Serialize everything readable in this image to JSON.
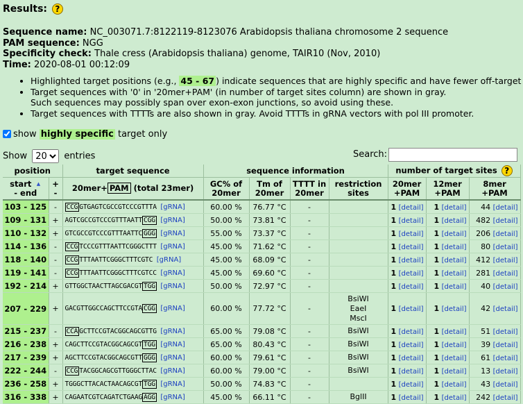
{
  "header": {
    "title": "Results:",
    "help_glyph": "?"
  },
  "info": {
    "seq_label": "Sequence name:",
    "seq_value": "NC_003071.7:8122119-8123076 Arabidopsis thaliana chromosome 2 sequence",
    "pam_label": "PAM sequence:",
    "pam_value": "NGG",
    "spec_label": "Specificity check:",
    "spec_value": "Thale cress (Arabidopsis thaliana) genome, TAIR10 (Nov, 2010)",
    "time_label": "Time:",
    "time_value": "2020-08-01 00:12:09"
  },
  "notes": {
    "n1_a": "Highlighted target positions (e.g., ",
    "n1_hl": "45 - 67",
    "n1_b": ") indicate sequences that are highly specific and have fewer off-target hits.",
    "n2": "Target sequences with '0' in '20mer+PAM' (in number of target sites column) are shown in gray.",
    "n3": "Such sequences may possibly span over exon-exon junctions, so avoid using these.",
    "n4": "Target sequences with TTTTs are also shown in gray. Avoid TTTTs in gRNA vectors with pol III promoter."
  },
  "filter": {
    "show": "show",
    "hl": "highly specific",
    "rest": "target only"
  },
  "entries": {
    "show": "Show",
    "value": "20",
    "suffix": "entries",
    "search_label": "Search:"
  },
  "columns": {
    "position": "position",
    "target_sequence": "target sequence",
    "sequence_information": "sequence information",
    "number_of_target_sites": "number of target sites",
    "start_end_1": "start",
    "start_end_2": "- end",
    "strand_1": "+",
    "strand_2": "-",
    "twentymer": "20mer+",
    "pam": "PAM",
    "total": "(total 23mer)",
    "gc_1": "GC% of",
    "gc_2": "20mer",
    "tm_1": "Tm of",
    "tm_2": "20mer",
    "tttt_1": "TTTT in",
    "tttt_2": "20mer",
    "restr_1": "restriction",
    "restr_2": "sites",
    "c20_1": "20mer",
    "c20_2": "+PAM",
    "c12_1": "12mer",
    "c12_2": "+PAM",
    "c8_1": "8mer",
    "c8_2": "+PAM"
  },
  "labels": {
    "grna": "[gRNA]",
    "detail": "[detail]"
  },
  "rows": [
    {
      "pos": "103 - 125",
      "strand": "-",
      "pre": "",
      "pambox": "CCG",
      "post": "GTGAGTCGCCGTCCCGTTTA",
      "gc": "60.00 %",
      "tm": "76.77 °C",
      "tttt": "-",
      "restr": "",
      "n20": "1",
      "n12": "1",
      "n8": "44"
    },
    {
      "pos": "109 - 131",
      "strand": "+",
      "pre": "AGTCGCCGTCCCGTTTAATT",
      "pambox": "CGG",
      "post": "",
      "gc": "50.00 %",
      "tm": "73.81 °C",
      "tttt": "-",
      "restr": "",
      "n20": "1",
      "n12": "1",
      "n8": "482"
    },
    {
      "pos": "110 - 132",
      "strand": "+",
      "pre": "GTCGCCGTCCCGTTTAATTC",
      "pambox": "GGG",
      "post": "",
      "gc": "55.00 %",
      "tm": "73.37 °C",
      "tttt": "-",
      "restr": "",
      "n20": "1",
      "n12": "1",
      "n8": "206"
    },
    {
      "pos": "114 - 136",
      "strand": "-",
      "pre": "",
      "pambox": "CCG",
      "post": "TCCCGTTTAATTCGGGCTTT",
      "gc": "45.00 %",
      "tm": "71.62 °C",
      "tttt": "-",
      "restr": "",
      "n20": "1",
      "n12": "1",
      "n8": "80"
    },
    {
      "pos": "118 - 140",
      "strand": "-",
      "pre": "",
      "pambox": "CCG",
      "post": "TTTAATTCGGGCTTTCGTC",
      "gc": "45.00 %",
      "tm": "68.09 °C",
      "tttt": "-",
      "restr": "",
      "n20": "1",
      "n12": "1",
      "n8": "412"
    },
    {
      "pos": "119 - 141",
      "strand": "-",
      "pre": "",
      "pambox": "CCG",
      "post": "TTTAATTCGGGCTTTCGTCC",
      "gc": "45.00 %",
      "tm": "69.60 °C",
      "tttt": "-",
      "restr": "",
      "n20": "1",
      "n12": "1",
      "n8": "281"
    },
    {
      "pos": "192 - 214",
      "strand": "+",
      "pre": "GTTGGCTAACTTAGCGACGT",
      "pambox": "TGG",
      "post": "",
      "gc": "50.00 %",
      "tm": "72.97 °C",
      "tttt": "-",
      "restr": "",
      "n20": "1",
      "n12": "1",
      "n8": "40"
    },
    {
      "pos": "207 - 229",
      "strand": "+",
      "pre": "GACGTTGGCCAGCTTCCGTA",
      "pambox": "CGG",
      "post": "",
      "gc": "60.00 %",
      "tm": "77.72 °C",
      "tttt": "-",
      "restr": "BsiWI\nEaeI\nMscI",
      "n20": "1",
      "n12": "1",
      "n8": "42",
      "tall": true
    },
    {
      "pos": "215 - 237",
      "strand": "-",
      "pre": "",
      "pambox": "CCA",
      "post": "GCTTCCGTACGGCAGCGTTG",
      "gc": "65.00 %",
      "tm": "79.08 °C",
      "tttt": "-",
      "restr": "BsiWI",
      "n20": "1",
      "n12": "1",
      "n8": "51"
    },
    {
      "pos": "216 - 238",
      "strand": "+",
      "pre": "CAGCTTCCGTACGGCAGCGT",
      "pambox": "TGG",
      "post": "",
      "gc": "65.00 %",
      "tm": "80.43 °C",
      "tttt": "-",
      "restr": "BsiWI",
      "n20": "1",
      "n12": "1",
      "n8": "39"
    },
    {
      "pos": "217 - 239",
      "strand": "+",
      "pre": "AGCTTCCGTACGGCAGCGTT",
      "pambox": "GGG",
      "post": "",
      "gc": "60.00 %",
      "tm": "79.61 °C",
      "tttt": "-",
      "restr": "BsiWI",
      "n20": "1",
      "n12": "1",
      "n8": "61"
    },
    {
      "pos": "222 - 244",
      "strand": "-",
      "pre": "",
      "pambox": "CCG",
      "post": "TACGGCAGCGTTGGGCTTAC",
      "gc": "60.00 %",
      "tm": "79.00 °C",
      "tttt": "-",
      "restr": "BsiWI",
      "n20": "1",
      "n12": "1",
      "n8": "13"
    },
    {
      "pos": "236 - 258",
      "strand": "+",
      "pre": "TGGGCTTACACTAACAGCGT",
      "pambox": "TGG",
      "post": "",
      "gc": "50.00 %",
      "tm": "74.83 °C",
      "tttt": "-",
      "restr": "",
      "n20": "1",
      "n12": "1",
      "n8": "43"
    },
    {
      "pos": "316 - 338",
      "strand": "+",
      "pre": "CAGAATCGTCAGATCTGAAG",
      "pambox": "AGG",
      "post": "",
      "gc": "45.00 %",
      "tm": "66.11 °C",
      "tttt": "-",
      "restr": "BglII",
      "n20": "1",
      "n12": "1",
      "n8": "242"
    }
  ]
}
